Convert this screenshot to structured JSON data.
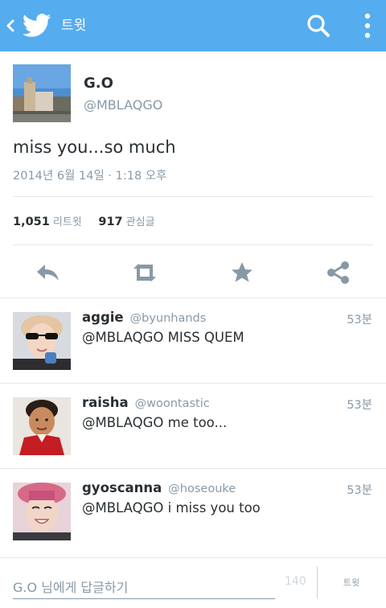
{
  "topbar": {
    "title": "트윗",
    "back_icon": "chevron-left-icon",
    "logo_icon": "twitter-bird-icon",
    "search_icon": "search-icon",
    "more_icon": "more-vertical-icon",
    "bar_color": "#55acee"
  },
  "tweet": {
    "name": "G.O",
    "handle": "@MBLAQGO",
    "text": "miss you...so much",
    "time": "2014년 6월 14일 · 1:18 오후",
    "retweets_count": "1,051",
    "retweets_label": "리트윗",
    "favorites_count": "917",
    "favorites_label": "관심글"
  },
  "actions": [
    "reply-icon",
    "retweet-icon",
    "favorite-star-icon",
    "share-icon"
  ],
  "replies": [
    {
      "name": "aggie",
      "handle": "@byunhands",
      "time": "53분",
      "text": "@MBLAQGO MISS QUEM"
    },
    {
      "name": "raisha",
      "handle": "@woontastic",
      "time": "53분",
      "text": "@MBLAQGO me too..."
    },
    {
      "name": "gyoscanna",
      "handle": "@hoseouke",
      "time": "53분",
      "text": "@MBLAQGO i miss you too"
    }
  ],
  "compose": {
    "placeholder": "G.O 님에게 답글하기",
    "char_count": "140",
    "button_label": "트윗"
  }
}
